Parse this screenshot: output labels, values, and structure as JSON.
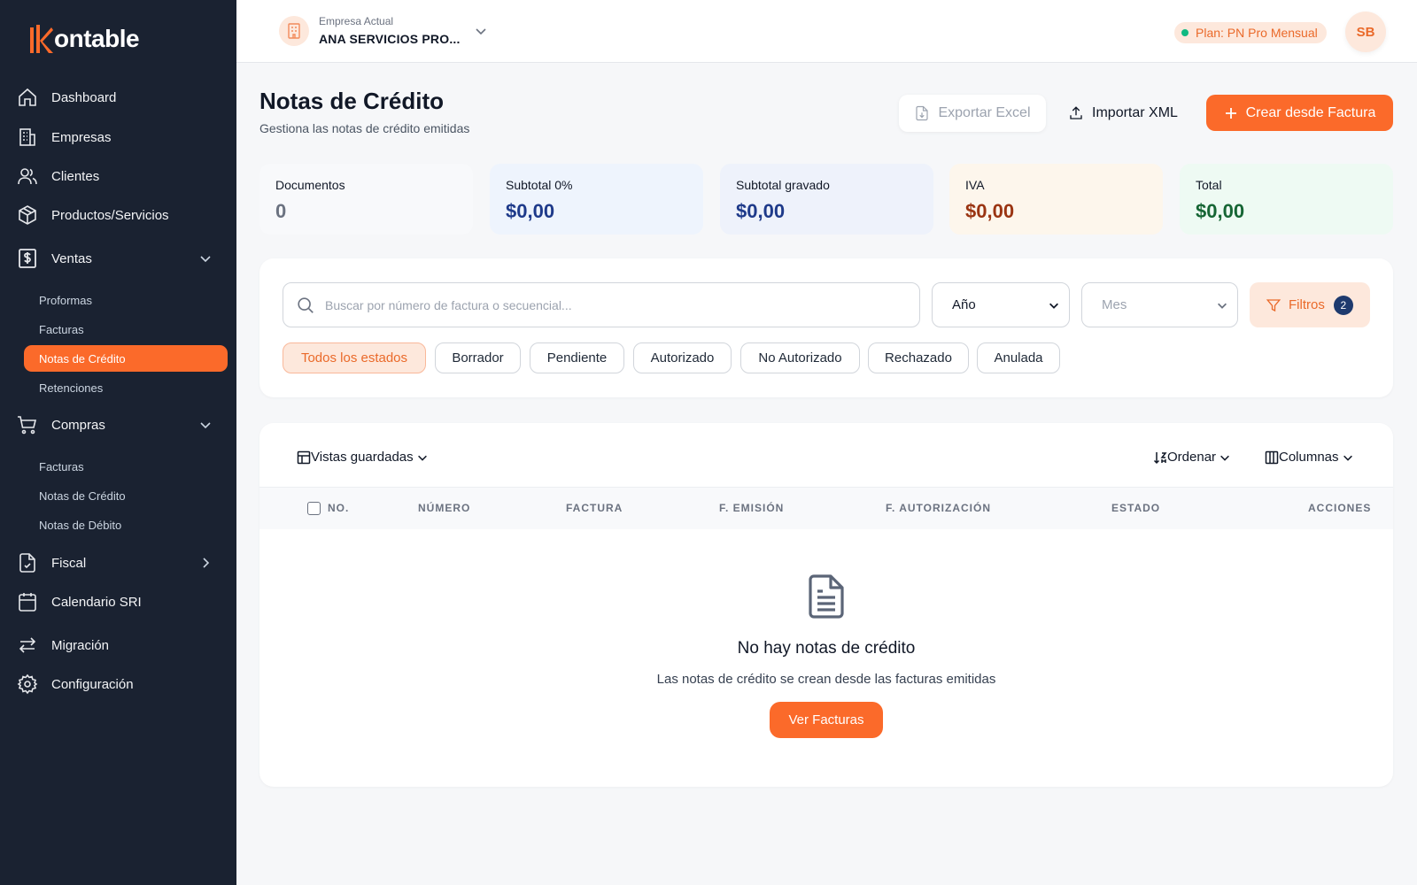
{
  "brand": {
    "name": "ontable",
    "accent": "#fb6a2a"
  },
  "sidebar": {
    "items": [
      {
        "label": "Dashboard",
        "icon": "home-icon"
      },
      {
        "label": "Empresas",
        "icon": "building-icon"
      },
      {
        "label": "Clientes",
        "icon": "users-icon"
      },
      {
        "label": "Productos/Servicios",
        "icon": "box-icon"
      },
      {
        "label": "Ventas",
        "icon": "dollar-icon",
        "sub": [
          "Proformas",
          "Facturas",
          "Notas de Crédito",
          "Retenciones"
        ],
        "active_sub": "Notas de Crédito"
      },
      {
        "label": "Compras",
        "icon": "cart-icon",
        "sub": [
          "Facturas",
          "Notas de Crédito",
          "Notas de Débito"
        ]
      },
      {
        "label": "Fiscal",
        "icon": "file-check-icon"
      },
      {
        "label": "Calendario SRI",
        "icon": "calendar-icon"
      },
      {
        "label": "Migración",
        "icon": "swap-icon"
      },
      {
        "label": "Configuración",
        "icon": "gear-icon"
      }
    ]
  },
  "topbar": {
    "company_label": "Empresa Actual",
    "company_name": "ANA SERVICIOS PRO...",
    "plan": "Plan: PN Pro Mensual",
    "avatar_initials": "SB"
  },
  "page": {
    "title": "Notas de Crédito",
    "subtitle": "Gestiona las notas de crédito emitidas",
    "export_label": "Exportar Excel",
    "import_label": "Importar XML",
    "create_label": "Crear desde Factura"
  },
  "stats": [
    {
      "label": "Documentos",
      "value": "0",
      "bg": "#f8f9fb",
      "color": "#6b7280"
    },
    {
      "label": "Subtotal 0%",
      "value": "$0,00",
      "bg": "#eef4fd",
      "color": "#1e3a8a"
    },
    {
      "label": "Subtotal gravado",
      "value": "$0,00",
      "bg": "#eef2fb",
      "color": "#1e3a8a"
    },
    {
      "label": "IVA",
      "value": "$0,00",
      "bg": "#fdf6ec",
      "color": "#9a3412"
    },
    {
      "label": "Total",
      "value": "$0,00",
      "bg": "#eefaf3",
      "color": "#166534"
    }
  ],
  "filters": {
    "search_placeholder": "Buscar por número de factura o secuencial...",
    "year_value": "Año",
    "month_value": "Mes",
    "filters_label": "Filtros",
    "filters_count": "2",
    "status_chips": [
      "Todos los estados",
      "Borrador",
      "Pendiente",
      "Autorizado",
      "No Autorizado",
      "Rechazado",
      "Anulada"
    ]
  },
  "table": {
    "saved_views": "Vistas guardadas",
    "sort": "Ordenar",
    "columns_btn": "Columnas",
    "columns": [
      "NO.",
      "NÚMERO",
      "FACTURA",
      "F. EMISIÓN",
      "F. AUTORIZACIÓN",
      "ESTADO",
      "ACCIONES"
    ],
    "empty_title": "No hay notas de crédito",
    "empty_sub": "Las notas de crédito se crean desde las facturas emitidas",
    "empty_button": "Ver Facturas"
  }
}
